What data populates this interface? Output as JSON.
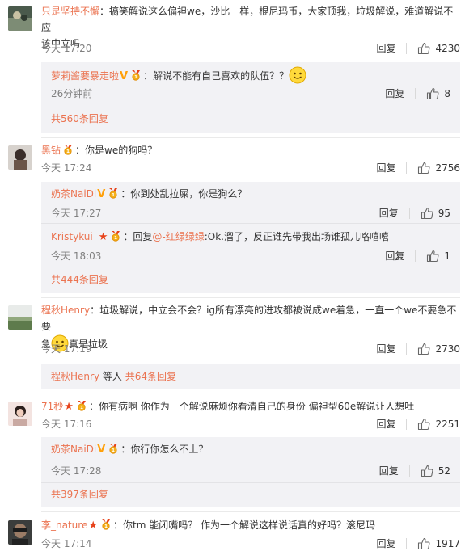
{
  "comments": [
    {
      "user": "只是坚持不懈",
      "text_line1": "：搞笑解说这么偏袒we，沙比一样，棍尼玛币，大家顶我，垃圾解说，难道解说不应",
      "text_line2": "该中立吗",
      "time": "今天 17:20",
      "reply": "回复",
      "likes": "4230",
      "sub": [
        {
          "user": "萝莉酱要暴走啦",
          "text": "：解说不能有自己喜欢的队伍？？",
          "time": "26分钟前",
          "reply": "回复",
          "likes": "8"
        }
      ],
      "more": "共560条回复"
    },
    {
      "user": "黑钻",
      "text": "：你是we的狗吗？",
      "time": "今天 17:24",
      "reply": "回复",
      "likes": "2756",
      "sub": [
        {
          "user": "奶茶NaiDi",
          "text": "：你到处乱拉屎，你是狗么？",
          "time": "今天 17:27",
          "reply": "回复",
          "likes": "95"
        },
        {
          "user": "Kristykui_",
          "text_pre": "：回复",
          "mention": "@-红绿绿绿",
          "text_post": ":Ok.溜了，反正谁先带我出场谁孤儿咯嘻嘻",
          "time": "今天 18:03",
          "reply": "回复",
          "likes": "1"
        }
      ],
      "more": "共444条回复"
    },
    {
      "user": "程秋Henry",
      "text_line1": "：垃圾解说，中立会不会？ig所有漂亮的进攻都被说成we着急，一直一个we不要急不要",
      "text_line2_pre": "急",
      "text_line2_post": "真是垃圾",
      "time": "今天 17:19",
      "reply": "回复",
      "likes": "2730",
      "more_user": "程秋Henry",
      "more_mid": " 等人 ",
      "more": "共64条回复"
    },
    {
      "user": "71秒",
      "text": "：你有病啊 你作为一个解说麻烦你看清自己的身份 偏袒型60e解说让人想吐",
      "time": "今天 17:16",
      "reply": "回复",
      "likes": "2251",
      "sub": [
        {
          "user": "奶茶NaiDi",
          "text": "：你行你怎么不上？",
          "time": "今天 17:28",
          "reply": "回复",
          "likes": "52"
        }
      ],
      "more": "共397条回复"
    },
    {
      "user": "李_nature",
      "text": "：你tm 能闭嘴吗？ 作为一个解说这样说话真的好吗？滚尼玛",
      "time": "今天 17:14",
      "reply": "回复",
      "likes": "1917"
    }
  ]
}
